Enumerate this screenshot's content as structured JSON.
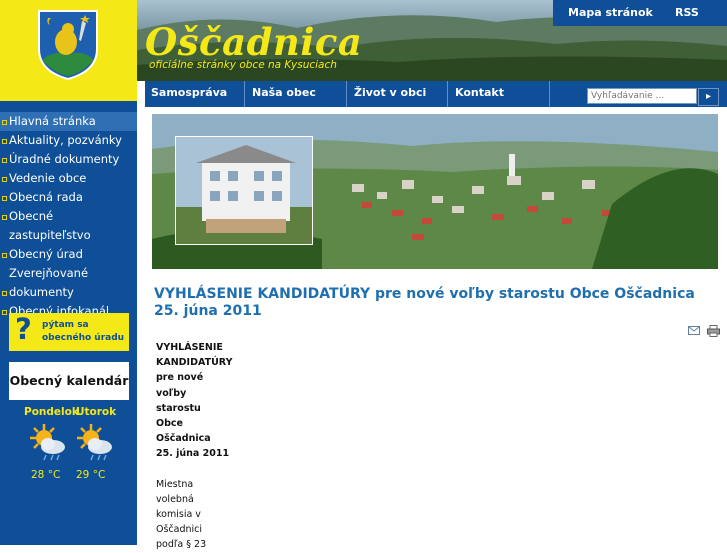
{
  "header": {
    "site_name": "Oščadnica",
    "tagline": "oficiálne stránky obce na Kysuciach",
    "top_links": [
      "Mapa stránok",
      "RSS"
    ]
  },
  "main_nav": [
    "Samospráva",
    "Naša obec",
    "Život v obci",
    "Kontakt"
  ],
  "search": {
    "placeholder": "Vyhľadávanie ..."
  },
  "left_menu": [
    "Hlavná stránka",
    "Aktuality, pozvánky",
    "Úradné dokumenty",
    "Vedenie obce",
    "Obecná rada",
    "Obecné zastupiteľstvo",
    "Obecný úrad",
    "Zverejňované dokumenty",
    "Obecný infokanál"
  ],
  "sidebar": {
    "ask_symbol": "?",
    "ask_line1": "pýtam sa",
    "ask_line2": "obecného úradu",
    "calendar": "Obecný kalendár"
  },
  "weather": [
    {
      "day": "Pondelok",
      "temp": "28 °C"
    },
    {
      "day": "Utorok",
      "temp": "29 °C"
    }
  ],
  "article": {
    "title": "VYHLÁSENIE KANDIDATÚRY pre nové voľby starostu Obce Oščadnica 25. júna 2011",
    "bold_lines": [
      "VYHLÁSENIE",
      "KANDIDATÚRY",
      "pre nové",
      "voľby",
      "starostu",
      "Obce",
      "Oščadnica",
      "25. júna 2011"
    ],
    "body_lines": [
      "Miestna",
      "volebná",
      "komisia v",
      "Oščadnici",
      "podľa § 23"
    ]
  },
  "colors": {
    "brand_blue": "#0e4f97",
    "brand_yellow": "#f4e916",
    "title_blue": "#1f6fb0"
  },
  "icons": [
    "email-icon",
    "print-icon",
    "search-arrow-icon",
    "sun-cloud-icon"
  ]
}
